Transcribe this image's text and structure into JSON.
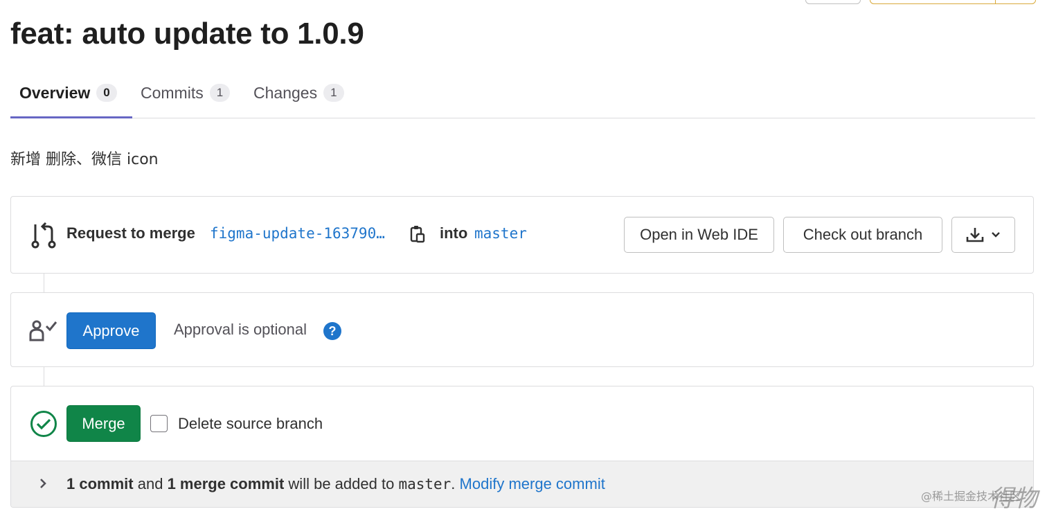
{
  "header": {
    "title": "feat: auto update to 1.0.9"
  },
  "tabs": [
    {
      "label": "Overview",
      "count": "0"
    },
    {
      "label": "Commits",
      "count": "1"
    },
    {
      "label": "Changes",
      "count": "1"
    }
  ],
  "description": "新增 删除、微信 icon",
  "merge_request": {
    "request_label": "Request to merge",
    "source_branch": "figma-update-163790…",
    "into_label": "into",
    "target_branch": "master",
    "open_ide_label": "Open in Web IDE",
    "checkout_label": "Check out branch"
  },
  "approval": {
    "approve_label": "Approve",
    "status_text": "Approval is optional",
    "help_glyph": "?"
  },
  "merge": {
    "merge_label": "Merge",
    "delete_branch_label": "Delete source branch",
    "delete_branch_checked": false,
    "footer": {
      "commit_count": "1 commit",
      "and_text": "and",
      "merge_commit": "1 merge commit",
      "added_text": "will be added to",
      "target": "master",
      "period": ".",
      "modify_link": "Modify merge commit"
    }
  },
  "watermark": {
    "text": "@稀土掘金技术社区",
    "logo_text": "得物"
  },
  "colors": {
    "primary": "#1f75cb",
    "success": "#108548",
    "tab_underline": "#6666c4"
  },
  "icons": {
    "merge_request": "git-merge-request-icon",
    "copy": "copy-to-clipboard-icon",
    "approval": "approval-user-icon",
    "status": "check-circle-icon",
    "download": "download-icon",
    "chevron_down": "chevron-down-icon",
    "chevron_right": "chevron-right-icon"
  }
}
